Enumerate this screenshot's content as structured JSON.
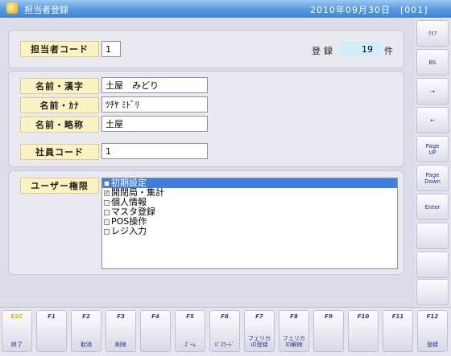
{
  "title": {
    "app_title": "担当者登録",
    "date_text": "2010年09月30日　[001]"
  },
  "header": {
    "code_label": "担当者コード",
    "code_value": "1",
    "register_label": "登録",
    "count_value": "19",
    "count_unit": "件"
  },
  "names": {
    "kanji_label": "名前・漢字",
    "kanji_value": "土屋　みどり",
    "kana_label": "名前・ｶﾅ",
    "kana_value": "ﾂﾁﾔ ﾐﾄﾞﾘ",
    "short_label": "名前・略称",
    "short_value": "土屋",
    "employee_label": "社員コード",
    "employee_value": "1"
  },
  "permissions": {
    "label": "ユーザー権限",
    "items": [
      {
        "label": "初期設定",
        "checked": false,
        "selected": true
      },
      {
        "label": "開閉局・集計",
        "checked": true,
        "selected": false
      },
      {
        "label": "個人情報",
        "checked": false,
        "selected": false
      },
      {
        "label": "マスタ登録",
        "checked": false,
        "selected": false
      },
      {
        "label": "POS操作",
        "checked": false,
        "selected": false
      },
      {
        "label": "レジ入力",
        "checked": false,
        "selected": false
      }
    ]
  },
  "sidebar": {
    "clear": "ｸﾘｱ",
    "bs": "BS",
    "right": "→",
    "left": "←",
    "pageup": "Page\nUP",
    "pagedown": "Page\nDown",
    "enter": "Enter"
  },
  "fkeys": [
    {
      "key": "ESC",
      "label": "終了"
    },
    {
      "key": "F1",
      "label": ""
    },
    {
      "key": "F2",
      "label": "取消"
    },
    {
      "key": "F3",
      "label": "削除"
    },
    {
      "key": "F4",
      "label": ""
    },
    {
      "key": "F5",
      "label": "ｽﾞｰﾑ"
    },
    {
      "key": "F6",
      "label": "ﾊﾟｽﾜｰﾄﾞ"
    },
    {
      "key": "F7",
      "label": "フェリカ\nID登録"
    },
    {
      "key": "F8",
      "label": "フェリカ\nID解除"
    },
    {
      "key": "F9",
      "label": ""
    },
    {
      "key": "F10",
      "label": ""
    },
    {
      "key": "F11",
      "label": ""
    },
    {
      "key": "F12",
      "label": "登録"
    }
  ]
}
